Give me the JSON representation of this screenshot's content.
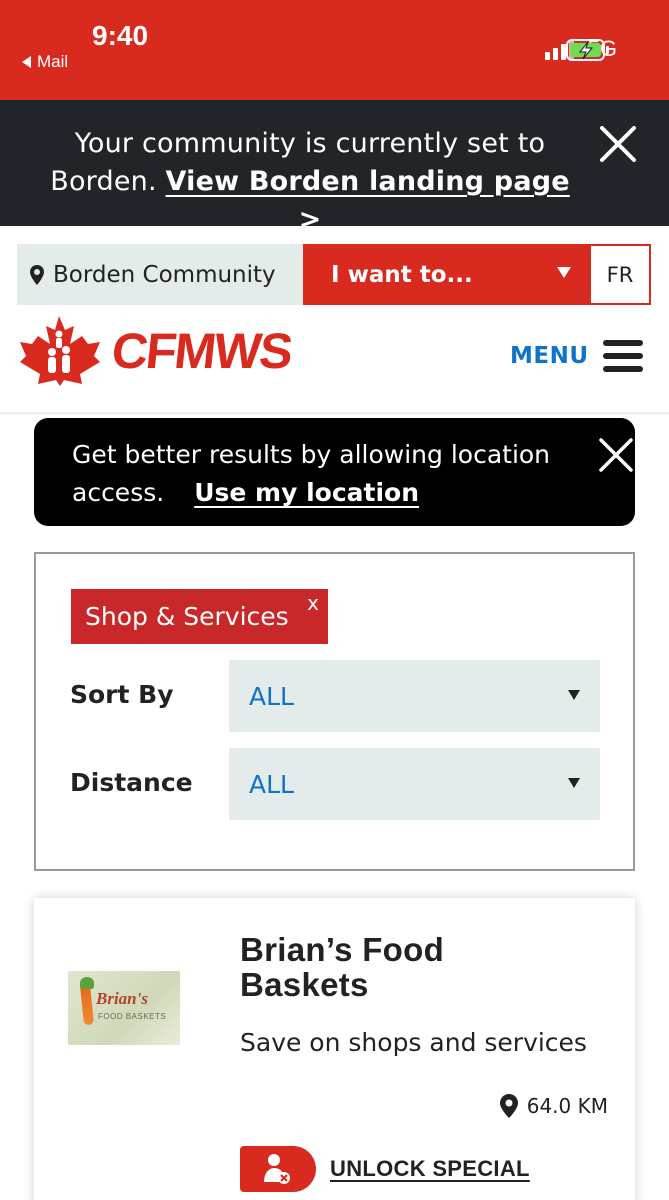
{
  "status_bar": {
    "time": "9:40",
    "back_app": "Mail",
    "network": "5G",
    "signal_icon": "signal-bars-icon",
    "battery_icon": "battery-charging-icon"
  },
  "community_banner": {
    "text": "Your community is currently set to Borden.",
    "link": "View Borden landing page >",
    "close_icon": "close-icon"
  },
  "top_bar": {
    "community": "Borden Community",
    "i_want_to": "I want to...",
    "language": "FR"
  },
  "header": {
    "logo_text": "CFMWS",
    "menu_label": "MENU"
  },
  "location_toast": {
    "text": "Get better results by allowing location access.",
    "link": "Use my location"
  },
  "filters": {
    "active_tag": "Shop & Services",
    "tag_remove": "x",
    "sort_label": "Sort By",
    "sort_value": "ALL",
    "distance_label": "Distance",
    "distance_value": "ALL"
  },
  "result": {
    "title": "Brian’s Food Baskets",
    "subtitle": "Save on shops and services",
    "distance": "64.0 KM",
    "action": "UNLOCK SPECIAL",
    "thumb_title": "Brian's",
    "thumb_sub": "FOOD BASKETS"
  },
  "colors": {
    "brand_red": "#d92a1f",
    "dark_banner": "#212529",
    "link_blue": "#0f74c9",
    "chip_grey": "#e4ebeb"
  }
}
